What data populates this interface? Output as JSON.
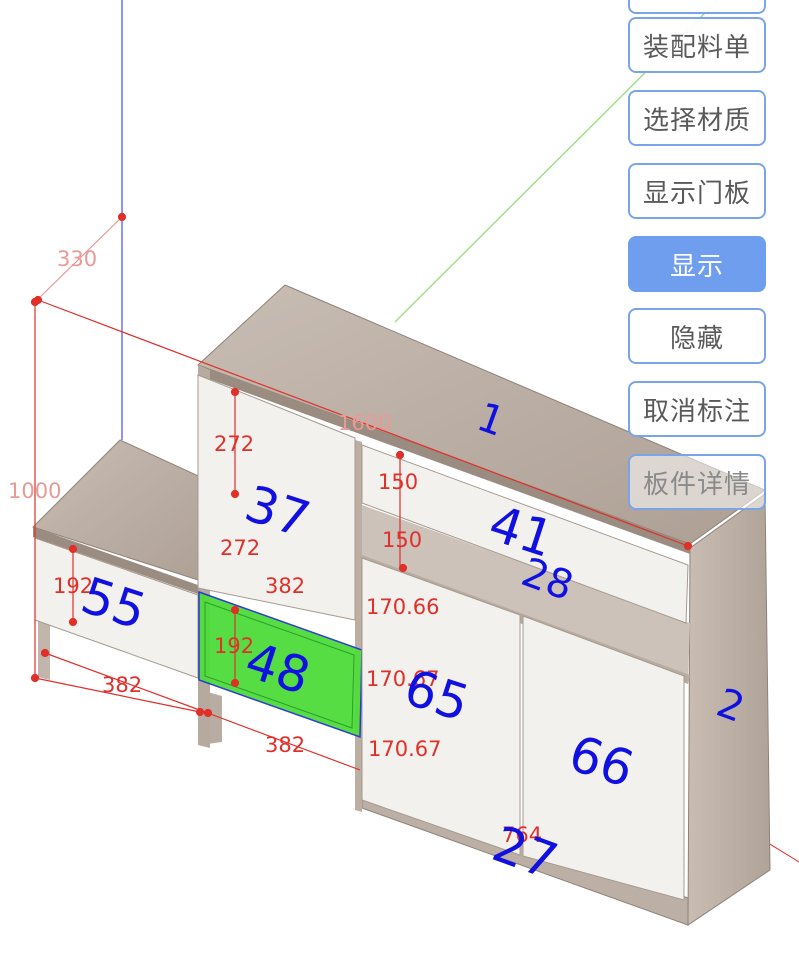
{
  "toolbar": {
    "buttons": [
      {
        "label": ""
      },
      {
        "label": "装配料单"
      },
      {
        "label": "选择材质"
      },
      {
        "label": "显示门板"
      },
      {
        "label": "显示",
        "active": true
      },
      {
        "label": "隐藏"
      },
      {
        "label": "取消标注"
      },
      {
        "label": "板件详情"
      }
    ]
  },
  "dimensions": {
    "depth": "330",
    "total_width": "1600",
    "total_height": "1000",
    "d_272_a": "272",
    "d_272_b": "272",
    "d_382_upper": "382",
    "d_192_left": "192",
    "d_192_mid": "192",
    "d_382_base_left": "382",
    "d_382_base_mid": "382",
    "d_150_a": "150",
    "d_150_b": "150",
    "d_170_a": "170.66",
    "d_170_b": "170.67",
    "d_170_c": "170.67",
    "d_764": "764"
  },
  "parts": {
    "p1": "1",
    "p2": "2",
    "p27": "27",
    "p28": "28",
    "p37": "37",
    "p41": "41",
    "p48": "48",
    "p55": "55",
    "p65": "65",
    "p66": "66"
  },
  "colors": {
    "dimension_line": "#e0302a",
    "part_label": "#1010e0",
    "selected_panel": "#4fdc3a",
    "wood_top": "#b9aca2",
    "door_white": "#f3f1ed",
    "button_accent": "#6f9eef"
  }
}
